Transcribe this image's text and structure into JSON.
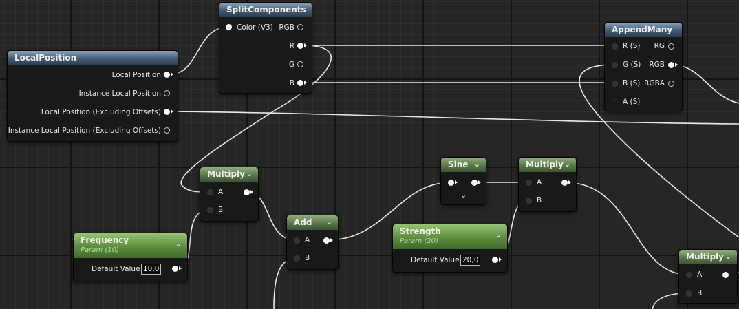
{
  "nodes": {
    "local_position": {
      "title": "LocalPosition",
      "pins": [
        "Local Position",
        "Instance Local Position",
        "Local Position (Excluding Offsets)",
        "Instance Local Position (Excluding Offsets)"
      ]
    },
    "split_components": {
      "title": "SplitComponents",
      "input": "Color (V3)",
      "outputs": [
        "RGB",
        "R",
        "G",
        "B"
      ]
    },
    "append_many": {
      "title": "AppendMany",
      "inputs": [
        "R (S)",
        "G (S)",
        "B (S)",
        "A (S)"
      ],
      "outputs": [
        "RG",
        "RGB",
        "RGBA"
      ]
    },
    "multiply_1": {
      "title": "Multiply",
      "inputs": [
        "A",
        "B"
      ]
    },
    "add": {
      "title": "Add",
      "inputs": [
        "A",
        "B"
      ]
    },
    "sine": {
      "title": "Sine"
    },
    "multiply_2": {
      "title": "Multiply",
      "inputs": [
        "A",
        "B"
      ]
    },
    "multiply_3": {
      "title": "Multiply",
      "inputs": [
        "A",
        "B"
      ]
    },
    "frequency": {
      "title": "Frequency",
      "subtitle": "Param (10)",
      "default_label": "Default Value",
      "default_value": "10,0"
    },
    "strength": {
      "title": "Strength",
      "subtitle": "Param (20)",
      "default_label": "Default Value",
      "default_value": "20,0"
    }
  },
  "icons": {
    "collapse": "chevron-down-icon",
    "expand": "chevron-down-icon"
  },
  "colors": {
    "wire": "#e9e9e9",
    "grid_bg": "#262626",
    "header_blue": "#3f5a76",
    "header_green": "#587a46"
  }
}
